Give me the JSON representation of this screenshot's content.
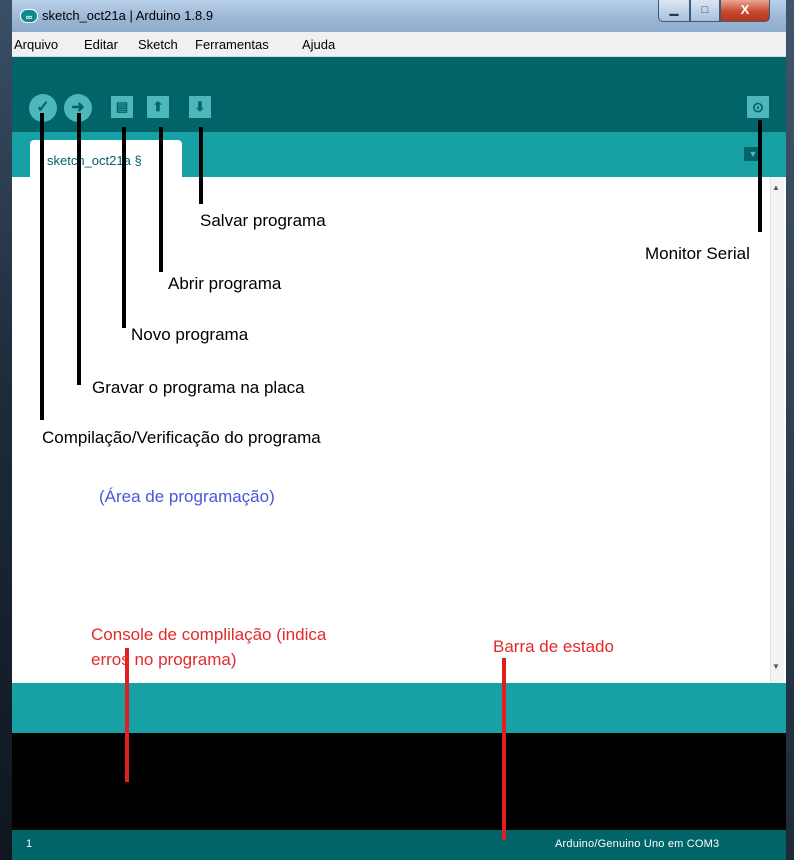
{
  "window": {
    "title": "sketch_oct21a | Arduino 1.8.9",
    "app_icon_glyph": "∞",
    "minimize_glyph": "▁",
    "maximize_glyph": "□",
    "close_glyph": "X"
  },
  "menu": {
    "items": [
      "Arquivo",
      "Editar",
      "Sketch",
      "Ferramentas",
      "Ajuda"
    ]
  },
  "toolbar": {
    "verify_icon": "check-icon",
    "verify_glyph": "✓",
    "upload_icon": "arrow-right-icon",
    "upload_glyph": "➜",
    "new_icon": "document-icon",
    "new_glyph": "▤",
    "open_icon": "arrow-up-icon",
    "open_glyph": "⬆",
    "save_icon": "arrow-down-icon",
    "save_glyph": "⬇",
    "serial_monitor_icon": "magnifier-icon",
    "serial_monitor_glyph": "⊙",
    "tab_menu_glyph": "▼"
  },
  "tab": {
    "label": "sketch_oct21a §"
  },
  "annotations": {
    "save": "Salvar programa",
    "serial_monitor": "Monitor Serial",
    "open": "Abrir programa",
    "new": "Novo programa",
    "upload": "Gravar o programa na placa",
    "verify": "Compilação/Verificação do programa",
    "editor_area": "(Área de programação)",
    "console_line1": "Console de complilação (indica",
    "console_line2": "erros no programa)",
    "status_bar": "Barra de estado"
  },
  "status": {
    "line_number": "1",
    "board": "Arduino/Genuino Uno em COM3"
  },
  "colors": {
    "toolbar": "#006468",
    "tabstrip": "#17a1a5",
    "button": "#4db7bb",
    "console": "#000000",
    "annotation_blue": "#4a57d8",
    "annotation_red": "#e22a2a"
  }
}
